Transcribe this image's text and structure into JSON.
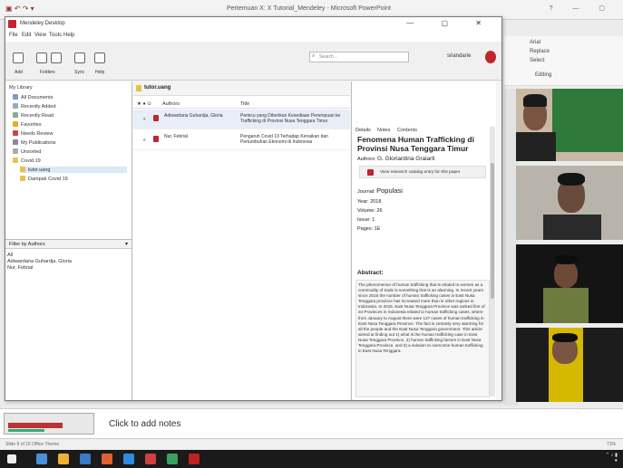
{
  "ppt": {
    "title": "Pertemuan X: X Tutorial_Mendeley - Microsoft PowerPoint",
    "ribbon": {
      "font": "Arial",
      "replace": "Replace",
      "select": "Select",
      "editing": "Editing"
    },
    "notes_placeholder": "Click to add notes",
    "status_left": "Slide 9 of 15    Office Theme",
    "status_right": "71%"
  },
  "mendeley": {
    "title": "Mendeley Desktop",
    "menu": [
      "File",
      "Edit",
      "View",
      "Tools",
      "Help"
    ],
    "toolbar": {
      "add_label": "Add",
      "folders_label": "Folders",
      "sync_label": "Sync",
      "help_label": "Help"
    },
    "search_placeholder": "Search...",
    "user_name": "sriandarie",
    "library": {
      "header": "My Library",
      "items": [
        "All Documents",
        "Recently Added",
        "Recently Read",
        "Favorites",
        "Needs Review",
        "My Publications",
        "Unsorted",
        "Covid 19",
        "tutor.uang",
        "Dampak Covid 19"
      ]
    },
    "filter": {
      "label": "Filter by Authors",
      "items": [
        "All",
        "Adiwardana Guhardja, Gloria",
        "Nur, Febrial"
      ]
    },
    "collection_title": "tutor.uang",
    "columns": {
      "authors": "Authors",
      "title": "Title"
    },
    "rows": [
      {
        "authors": "Adiwardana Guhardja, Gloria",
        "title": "Pemicu yang Diberikan Kesediaan Perempuan ke Trafficking di Provinsi Nusa Tenggara Timur"
      },
      {
        "authors": "Nur, Febrial",
        "title": "Pengaruh Covid 19 Terhadap Kenaikan dan Pertumbuhan Ekonomi di Indonesia"
      }
    ],
    "details": {
      "tabs": [
        "Details",
        "Notes",
        "Contents"
      ],
      "title": "Fenomena Human Trafficking di Provinsi Nusa Tenggara Timur",
      "authors_label": "Authors:",
      "authors": "G. Gloriardina Graiarti",
      "catalog_text": "View research catalog entry for this paper",
      "journal_label": "Journal:",
      "journal": "Populasi",
      "year_label": "Year:",
      "year": "2018",
      "volume_label": "Volume:",
      "volume": "26",
      "issue_label": "Issue:",
      "issue": "1",
      "pages_label": "Pages:",
      "pages": "1E",
      "abstract_label": "Abstract:",
      "abstract": "The phenomenon of human trafficking that is related to women as a commodity of trade is something that is an alarming. In recent years since 2015 the number of human trafficking cases in East Nusa Tenggara province has increased more than in other regions in Indonesia. In 2015, East Nusa Tenggara Province was ranked first of 34 Provinces in Indonesia related to human trafficking cases, where from January to August there were 137 cases of human trafficking in East Nusa Tenggara Province. The fact is certainly very alarming for all the people and the East Nusa Tenggara government. This article aimed at finding out 1) what is the human trafficking case in East Nusa Tenggara Province, 2) human trafficking factors in East Nusa Tenggara Province, and 3) a solution to overcome human trafficking in East Nusa Tenggara."
    }
  }
}
